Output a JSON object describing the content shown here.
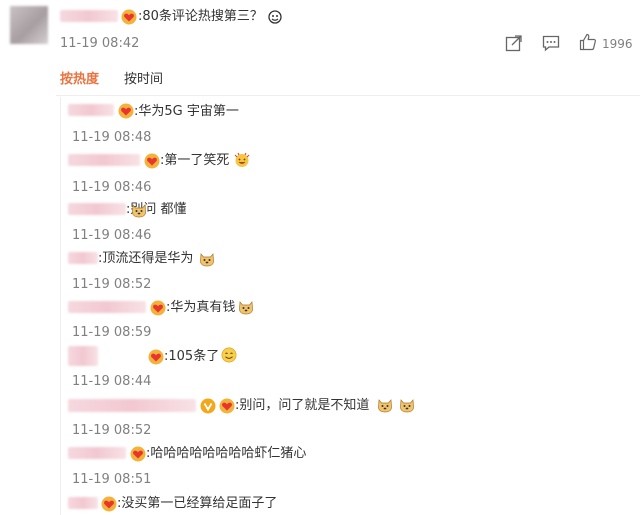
{
  "main_comment": {
    "text": ":80条评论热搜第三？",
    "time": "11-19 08:42",
    "like_count": "1996"
  },
  "sort_tabs": {
    "hot": "按热度",
    "time": "按时间"
  },
  "replies": [
    {
      "text": ":华为5G 宇宙第一",
      "time": "11-19 08:48"
    },
    {
      "text": ":第一了笑死",
      "time": "11-19 08:46"
    },
    {
      "text": ":别问 都懂",
      "time": "11-19 08:46"
    },
    {
      "text": ":顶流还得是华为",
      "time": "11-19 08:52"
    },
    {
      "text": ":华为真有钱",
      "time": "11-19 08:59"
    },
    {
      "text": ":105条了",
      "time": "11-19 08:44"
    },
    {
      "text": ":别问，问了就是不知道",
      "time": "11-19 08:52"
    },
    {
      "text": ":哈哈哈哈哈哈哈哈虾仁猪心",
      "time": "11-19 08:51"
    },
    {
      "text": ":没买第一已经算给足面子了",
      "time": ""
    }
  ],
  "icons": {
    "badge": "red-heart-badge-icon",
    "verified": "gold-v-verified-icon",
    "doge": "doge-emoji-icon",
    "smile": "smile-emoji-icon",
    "clap": "clap-emoji-icon",
    "share": "share-icon",
    "comment": "comment-icon",
    "like": "like-icon"
  },
  "colors": {
    "hot_tab": "#eb7340",
    "time_text": "#808080"
  }
}
